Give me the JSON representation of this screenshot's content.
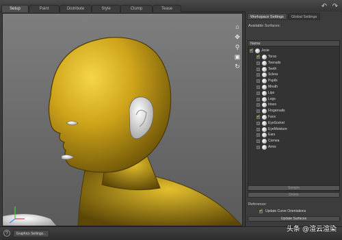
{
  "tabs": [
    "Setup",
    "Paint",
    "Distribute",
    "Style",
    "Clump",
    "Tease"
  ],
  "toolbar": {
    "undo_icon": "undo-icon",
    "redo_icon": "redo-icon"
  },
  "viewport": {
    "nav_icons": [
      "camera-icon",
      "pan-icon",
      "zoom-icon",
      "frame-icon",
      "orbit-icon"
    ],
    "figure_color": "#c9a61c"
  },
  "panel": {
    "tabs": [
      "Workspace Settings",
      "Global Settings"
    ],
    "available_surfaces_label": "Available Surfaces:",
    "column_header": "Name",
    "root": {
      "label": "Josie",
      "checked": true
    },
    "surfaces": [
      {
        "label": "Torso",
        "checked": true
      },
      {
        "label": "Toenails",
        "checked": false
      },
      {
        "label": "Teeth",
        "checked": false
      },
      {
        "label": "Sclera",
        "checked": false
      },
      {
        "label": "Pupils",
        "checked": false
      },
      {
        "label": "Mouth",
        "checked": false
      },
      {
        "label": "Lips",
        "checked": false
      },
      {
        "label": "Legs",
        "checked": false
      },
      {
        "label": "Irises",
        "checked": false
      },
      {
        "label": "Fingernails",
        "checked": false
      },
      {
        "label": "Face",
        "checked": true
      },
      {
        "label": "EyeSocket",
        "checked": false
      },
      {
        "label": "EyeMoisture",
        "checked": false
      },
      {
        "label": "Ears",
        "checked": false
      },
      {
        "label": "Cornea",
        "checked": false
      },
      {
        "label": "Arms",
        "checked": false
      }
    ],
    "button_1": "Sample",
    "button_2": "Delete",
    "reference_label": "Reference:",
    "update_curve_label": "Update Curve Orientations",
    "update_curve_checked": true,
    "update_surfaces_label": "Update Surfaces"
  },
  "statusbar": {
    "help_icon": "?",
    "graphics_settings_label": "Graphics Settings..."
  },
  "watermark": "头条 @渲云渲染",
  "colors": {
    "accent": "#e6c21a",
    "panel_bg": "#3c3c3c",
    "viewport_bg": "#6e6e6e"
  }
}
